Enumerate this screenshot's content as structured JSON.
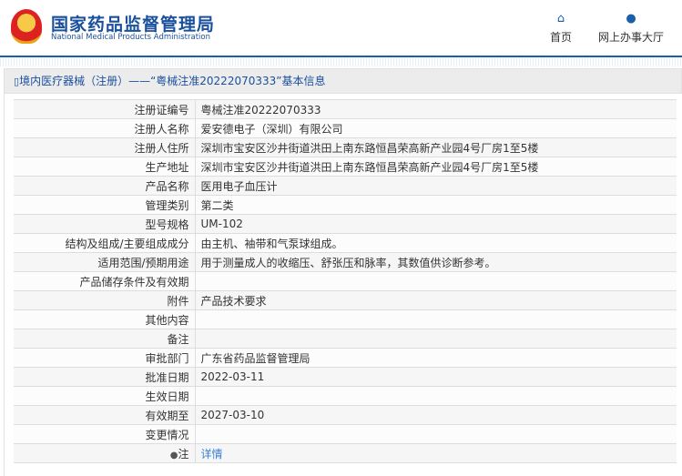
{
  "header": {
    "title_cn": "国家药品监督管理局",
    "title_en": "National Medical Products Administration",
    "nav": [
      {
        "label": "首页",
        "icon": "home-icon"
      },
      {
        "label": "网上办事大厅",
        "icon": "user-icon"
      }
    ]
  },
  "breadcrumb": "境内医疗器械（注册）——“粤械注准20222070333”基本信息",
  "rows": [
    {
      "label": "注册证编号",
      "value": "粤械注准20222070333"
    },
    {
      "label": "注册人名称",
      "value": "爱安德电子（深圳）有限公司"
    },
    {
      "label": "注册人住所",
      "value": "深圳市宝安区沙井街道洪田上南东路恒昌荣高新产业园4号厂房1至5楼"
    },
    {
      "label": "生产地址",
      "value": "深圳市宝安区沙井街道洪田上南东路恒昌荣高新产业园4号厂房1至5楼"
    },
    {
      "label": "产品名称",
      "value": "医用电子血压计"
    },
    {
      "label": "管理类别",
      "value": "第二类"
    },
    {
      "label": "型号规格",
      "value": "UM-102"
    },
    {
      "label": "结构及组成/主要组成成分",
      "value": "由主机、袖带和气泵球组成。"
    },
    {
      "label": "适用范围/预期用途",
      "value": "用于测量成人的收缩压、舒张压和脉率，其数值供诊断参考。"
    },
    {
      "label": "产品储存条件及有效期",
      "value": ""
    },
    {
      "label": "附件",
      "value": "产品技术要求"
    },
    {
      "label": "其他内容",
      "value": ""
    },
    {
      "label": "备注",
      "value": ""
    },
    {
      "label": "审批部门",
      "value": "广东省药品监督管理局"
    },
    {
      "label": "批准日期",
      "value": "2022-03-11"
    },
    {
      "label": "生效日期",
      "value": ""
    },
    {
      "label": "有效期至",
      "value": "2027-03-10"
    },
    {
      "label": "变更情况",
      "value": ""
    },
    {
      "label": "注",
      "value": "详情"
    }
  ]
}
